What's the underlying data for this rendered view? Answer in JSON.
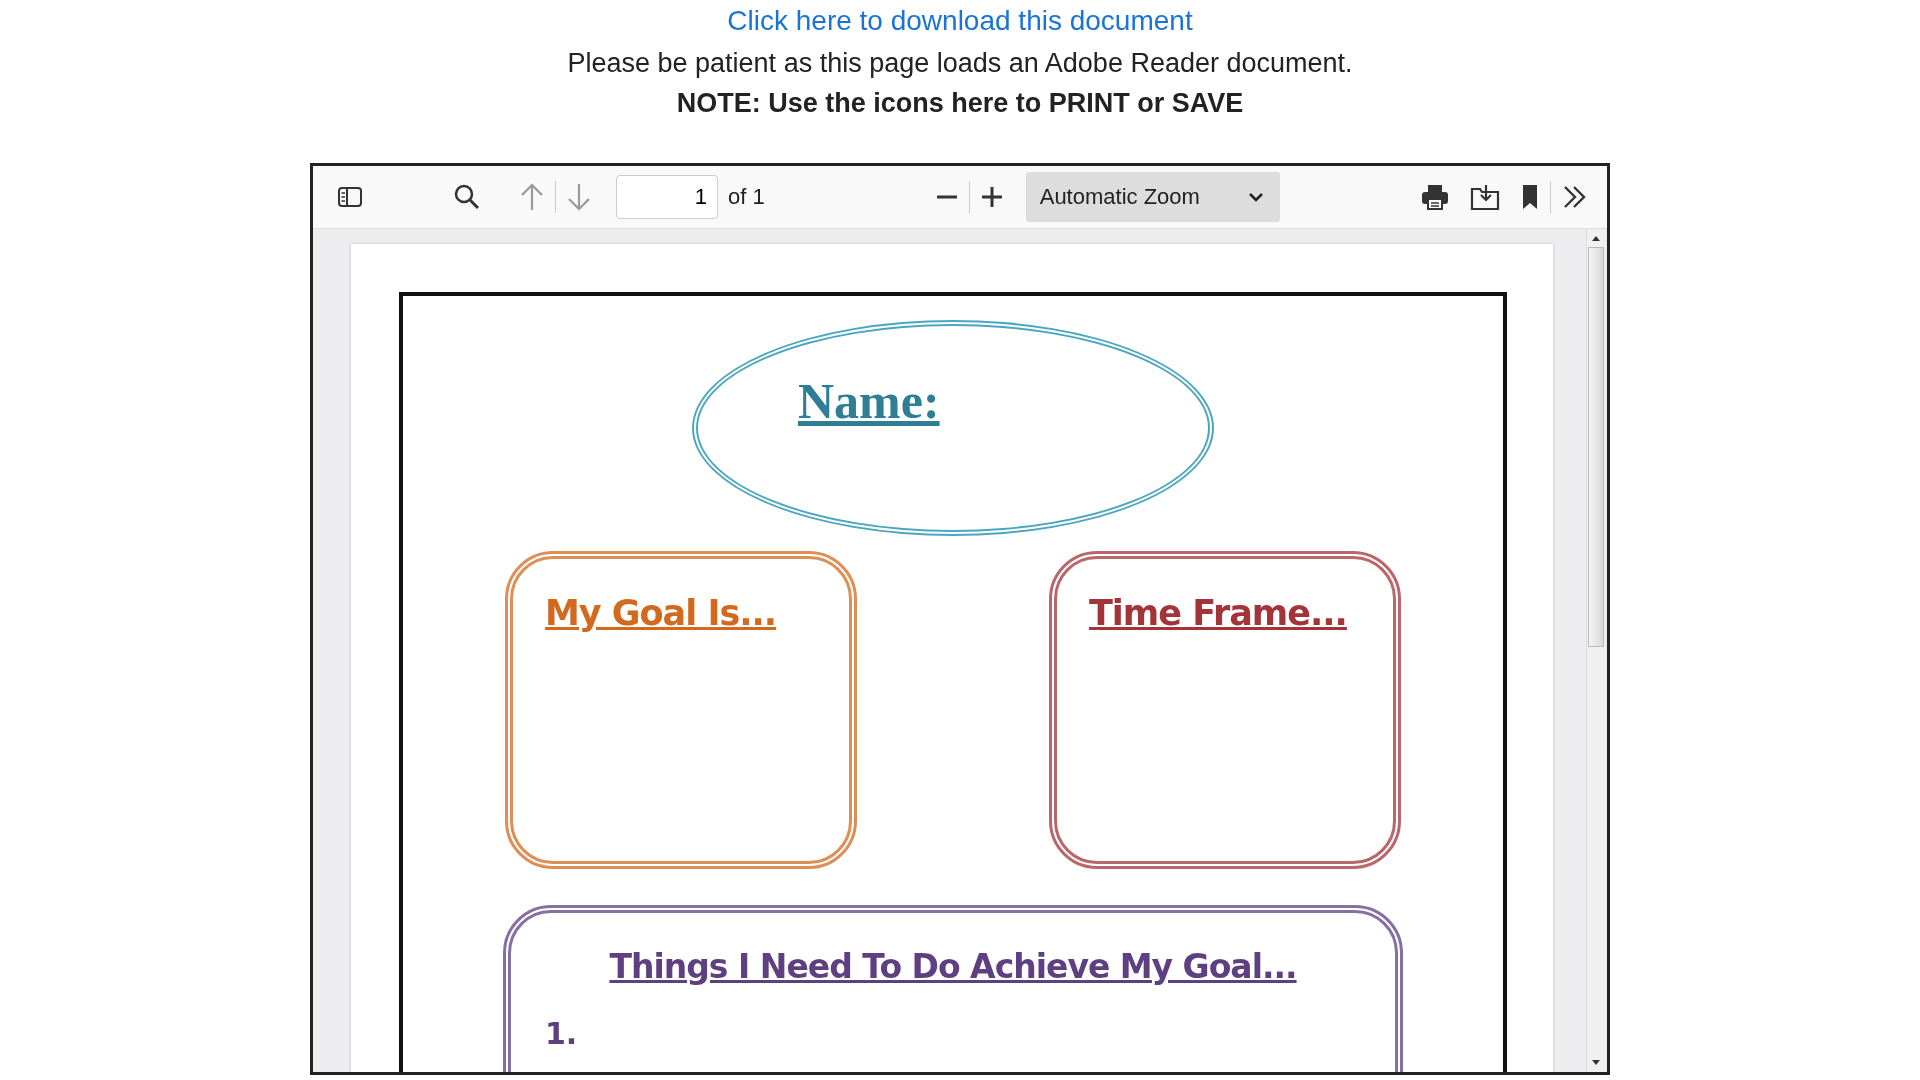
{
  "header": {
    "download_link": "Click here to download this document",
    "notice": "Please be patient as this page loads an Adobe Reader document.",
    "note": "NOTE: Use the icons here to PRINT or SAVE"
  },
  "toolbar": {
    "page_number": "1",
    "page_count": "of 1",
    "zoom": "Automatic Zoom"
  },
  "document": {
    "name_label": "Name:",
    "boxes": [
      {
        "title": "My Goal Is...",
        "color": "#d2691e"
      },
      {
        "title": "Time Frame...",
        "color": "#a3343a"
      }
    ],
    "tasks": {
      "title": "Things I Need To Do Achieve My Goal...",
      "color": "#5e3f82",
      "items": [
        "1."
      ]
    }
  }
}
